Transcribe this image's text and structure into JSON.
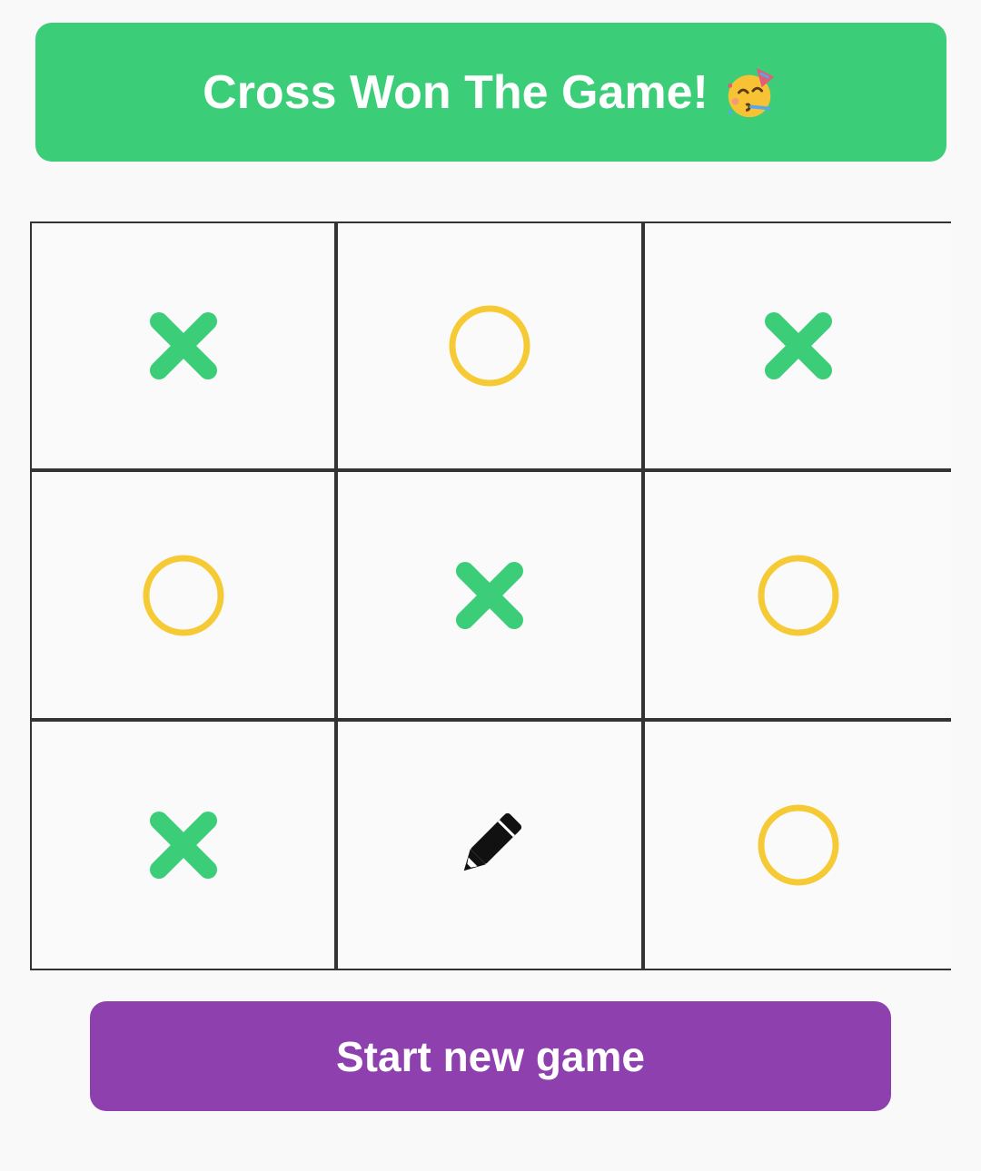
{
  "status": {
    "message": "Cross Won The Game!",
    "emoji_icon": "partying-face-icon"
  },
  "board": {
    "cells": [
      {
        "row": 1,
        "col": 1,
        "mark": "cross"
      },
      {
        "row": 1,
        "col": 2,
        "mark": "circle"
      },
      {
        "row": 1,
        "col": 3,
        "mark": "cross"
      },
      {
        "row": 2,
        "col": 1,
        "mark": "circle"
      },
      {
        "row": 2,
        "col": 2,
        "mark": "cross"
      },
      {
        "row": 2,
        "col": 3,
        "mark": "circle"
      },
      {
        "row": 3,
        "col": 1,
        "mark": "cross"
      },
      {
        "row": 3,
        "col": 2,
        "mark": "pencil"
      },
      {
        "row": 3,
        "col": 3,
        "mark": "circle"
      }
    ]
  },
  "actions": {
    "new_game_label": "Start new game"
  },
  "colors": {
    "cross": "#3ccd78",
    "circle": "#f5ca35",
    "pencil": "#111111",
    "banner": "#3ccd78",
    "button": "#8e40af",
    "grid": "#333333"
  }
}
